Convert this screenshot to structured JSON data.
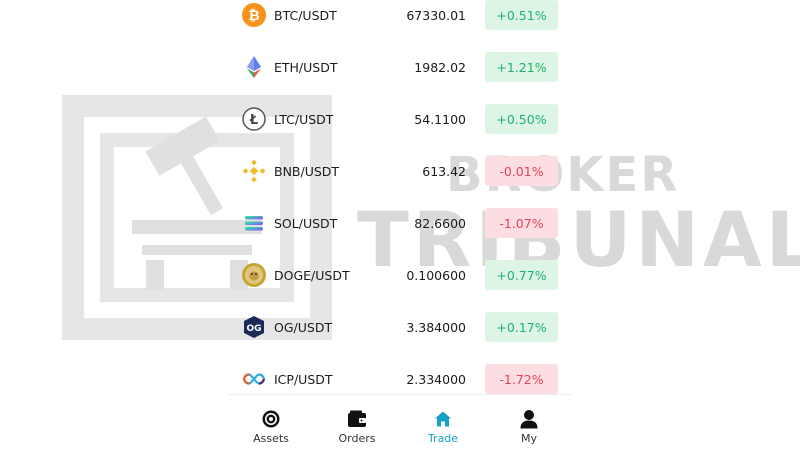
{
  "watermark": {
    "line1": "BROKER",
    "line2": "TRIBUNAL"
  },
  "markets": [
    {
      "pair": "BTC/USDT",
      "price": "67330.01",
      "change": "+0.51%",
      "direction": "up",
      "icon": "btc-icon",
      "color": "#f7931a"
    },
    {
      "pair": "ETH/USDT",
      "price": "1982.02",
      "change": "+1.21%",
      "direction": "up",
      "icon": "eth-icon",
      "color": "#627eea"
    },
    {
      "pair": "LTC/USDT",
      "price": "54.1100",
      "change": "+0.50%",
      "direction": "up",
      "icon": "ltc-icon",
      "color": "#345d9d"
    },
    {
      "pair": "BNB/USDT",
      "price": "613.42",
      "change": "-0.01%",
      "direction": "down",
      "icon": "bnb-icon",
      "color": "#f3ba2f"
    },
    {
      "pair": "SOL/USDT",
      "price": "82.6600",
      "change": "-1.07%",
      "direction": "down",
      "icon": "sol-icon",
      "color": "#9945ff"
    },
    {
      "pair": "DOGE/USDT",
      "price": "0.100600",
      "change": "+0.77%",
      "direction": "up",
      "icon": "doge-icon",
      "color": "#c2a633"
    },
    {
      "pair": "OG/USDT",
      "price": "3.384000",
      "change": "+0.17%",
      "direction": "up",
      "icon": "og-icon",
      "color": "#1b2a57"
    },
    {
      "pair": "ICP/USDT",
      "price": "2.334000",
      "change": "-1.72%",
      "direction": "down",
      "icon": "icp-icon",
      "color": "#29abe2"
    }
  ],
  "nav": [
    {
      "label": "Assets",
      "icon": "assets-icon",
      "active": false
    },
    {
      "label": "Orders",
      "icon": "wallet-icon",
      "active": false
    },
    {
      "label": "Trade",
      "icon": "home-icon",
      "active": true
    },
    {
      "label": "My",
      "icon": "user-icon",
      "active": false
    }
  ],
  "colors": {
    "up_text": "#20b26c",
    "up_bg": "#ddf5e5",
    "down_text": "#e8425a",
    "down_bg": "#fbdde2",
    "active_nav": "#18a0c6"
  }
}
